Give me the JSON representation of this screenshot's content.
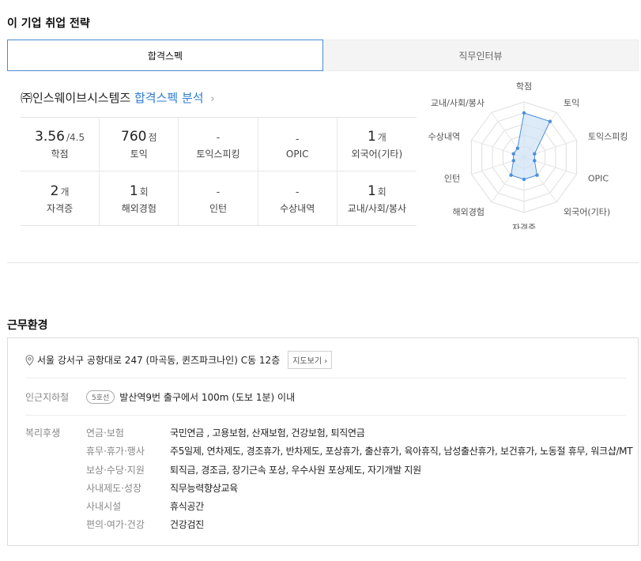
{
  "section1_title": "이 기업 취업 전략",
  "tabs": [
    {
      "label": "합격스펙",
      "active": true
    },
    {
      "label": "직무인터뷰",
      "active": false
    }
  ],
  "company": {
    "name": "㈜인스웨이브시스템즈",
    "link_text": "합격스펙 분석",
    "chevron": "›"
  },
  "specs": [
    {
      "value": "3.56",
      "unit": "/4.5",
      "label": "학점"
    },
    {
      "value": "760",
      "unit": "점",
      "label": "토익"
    },
    {
      "value": "-",
      "unit": "",
      "label": "토익스피킹"
    },
    {
      "value": "-",
      "unit": "",
      "label": "OPIC"
    },
    {
      "value": "1",
      "unit": "개",
      "label": "외국어(기타)"
    },
    {
      "value": "2",
      "unit": "개",
      "label": "자격증"
    },
    {
      "value": "1",
      "unit": "회",
      "label": "해외경험"
    },
    {
      "value": "-",
      "unit": "",
      "label": "인턴"
    },
    {
      "value": "-",
      "unit": "",
      "label": "수상내역"
    },
    {
      "value": "1",
      "unit": "회",
      "label": "교내/사회/봉사"
    }
  ],
  "radar": {
    "axes": [
      "학점",
      "토익",
      "토익스피킹",
      "OPIC",
      "외국어(기타)",
      "자격증",
      "해외경험",
      "인턴",
      "수상내역",
      "교내/사회/봉사"
    ],
    "levels": [
      0.8,
      0.8,
      0.2,
      0.2,
      0.4,
      0.4,
      0.4,
      0.2,
      0.2,
      0.2
    ],
    "fill_color": "#cfe3f7",
    "stroke_color": "#4a90d9"
  },
  "section2_title": "근무환경",
  "address": "서울 강서구 공항대로 247 (마곡동, 퀸즈파크나인) C동 12층",
  "map_button": "지도보기 ›",
  "subway": {
    "label": "인근지하철",
    "line": "5호선",
    "text": "발산역9번 출구에서 100m (도보 1분) 이내"
  },
  "benefits_label": "복리후생",
  "benefits": [
    {
      "category": "연금·보험",
      "value": "국민연금 , 고용보험, 산재보험, 건강보험, 퇴직연금"
    },
    {
      "category": "휴무·휴가·행사",
      "value": "주5일제, 연차제도, 경조휴가, 반차제도, 포상휴가, 출산휴가, 육아휴직, 남성출산휴가, 보건휴가, 노동절 휴무, 워크샵/MT"
    },
    {
      "category": "보상·수당·지원",
      "value": "퇴직금, 경조금, 장기근속 포상, 우수사원 포상제도, 자기개발 지원"
    },
    {
      "category": "사내제도·성장",
      "value": "직무능력향상교육"
    },
    {
      "category": "사내시설",
      "value": "휴식공간"
    },
    {
      "category": "편의·여가·건강",
      "value": "건강검진"
    }
  ]
}
